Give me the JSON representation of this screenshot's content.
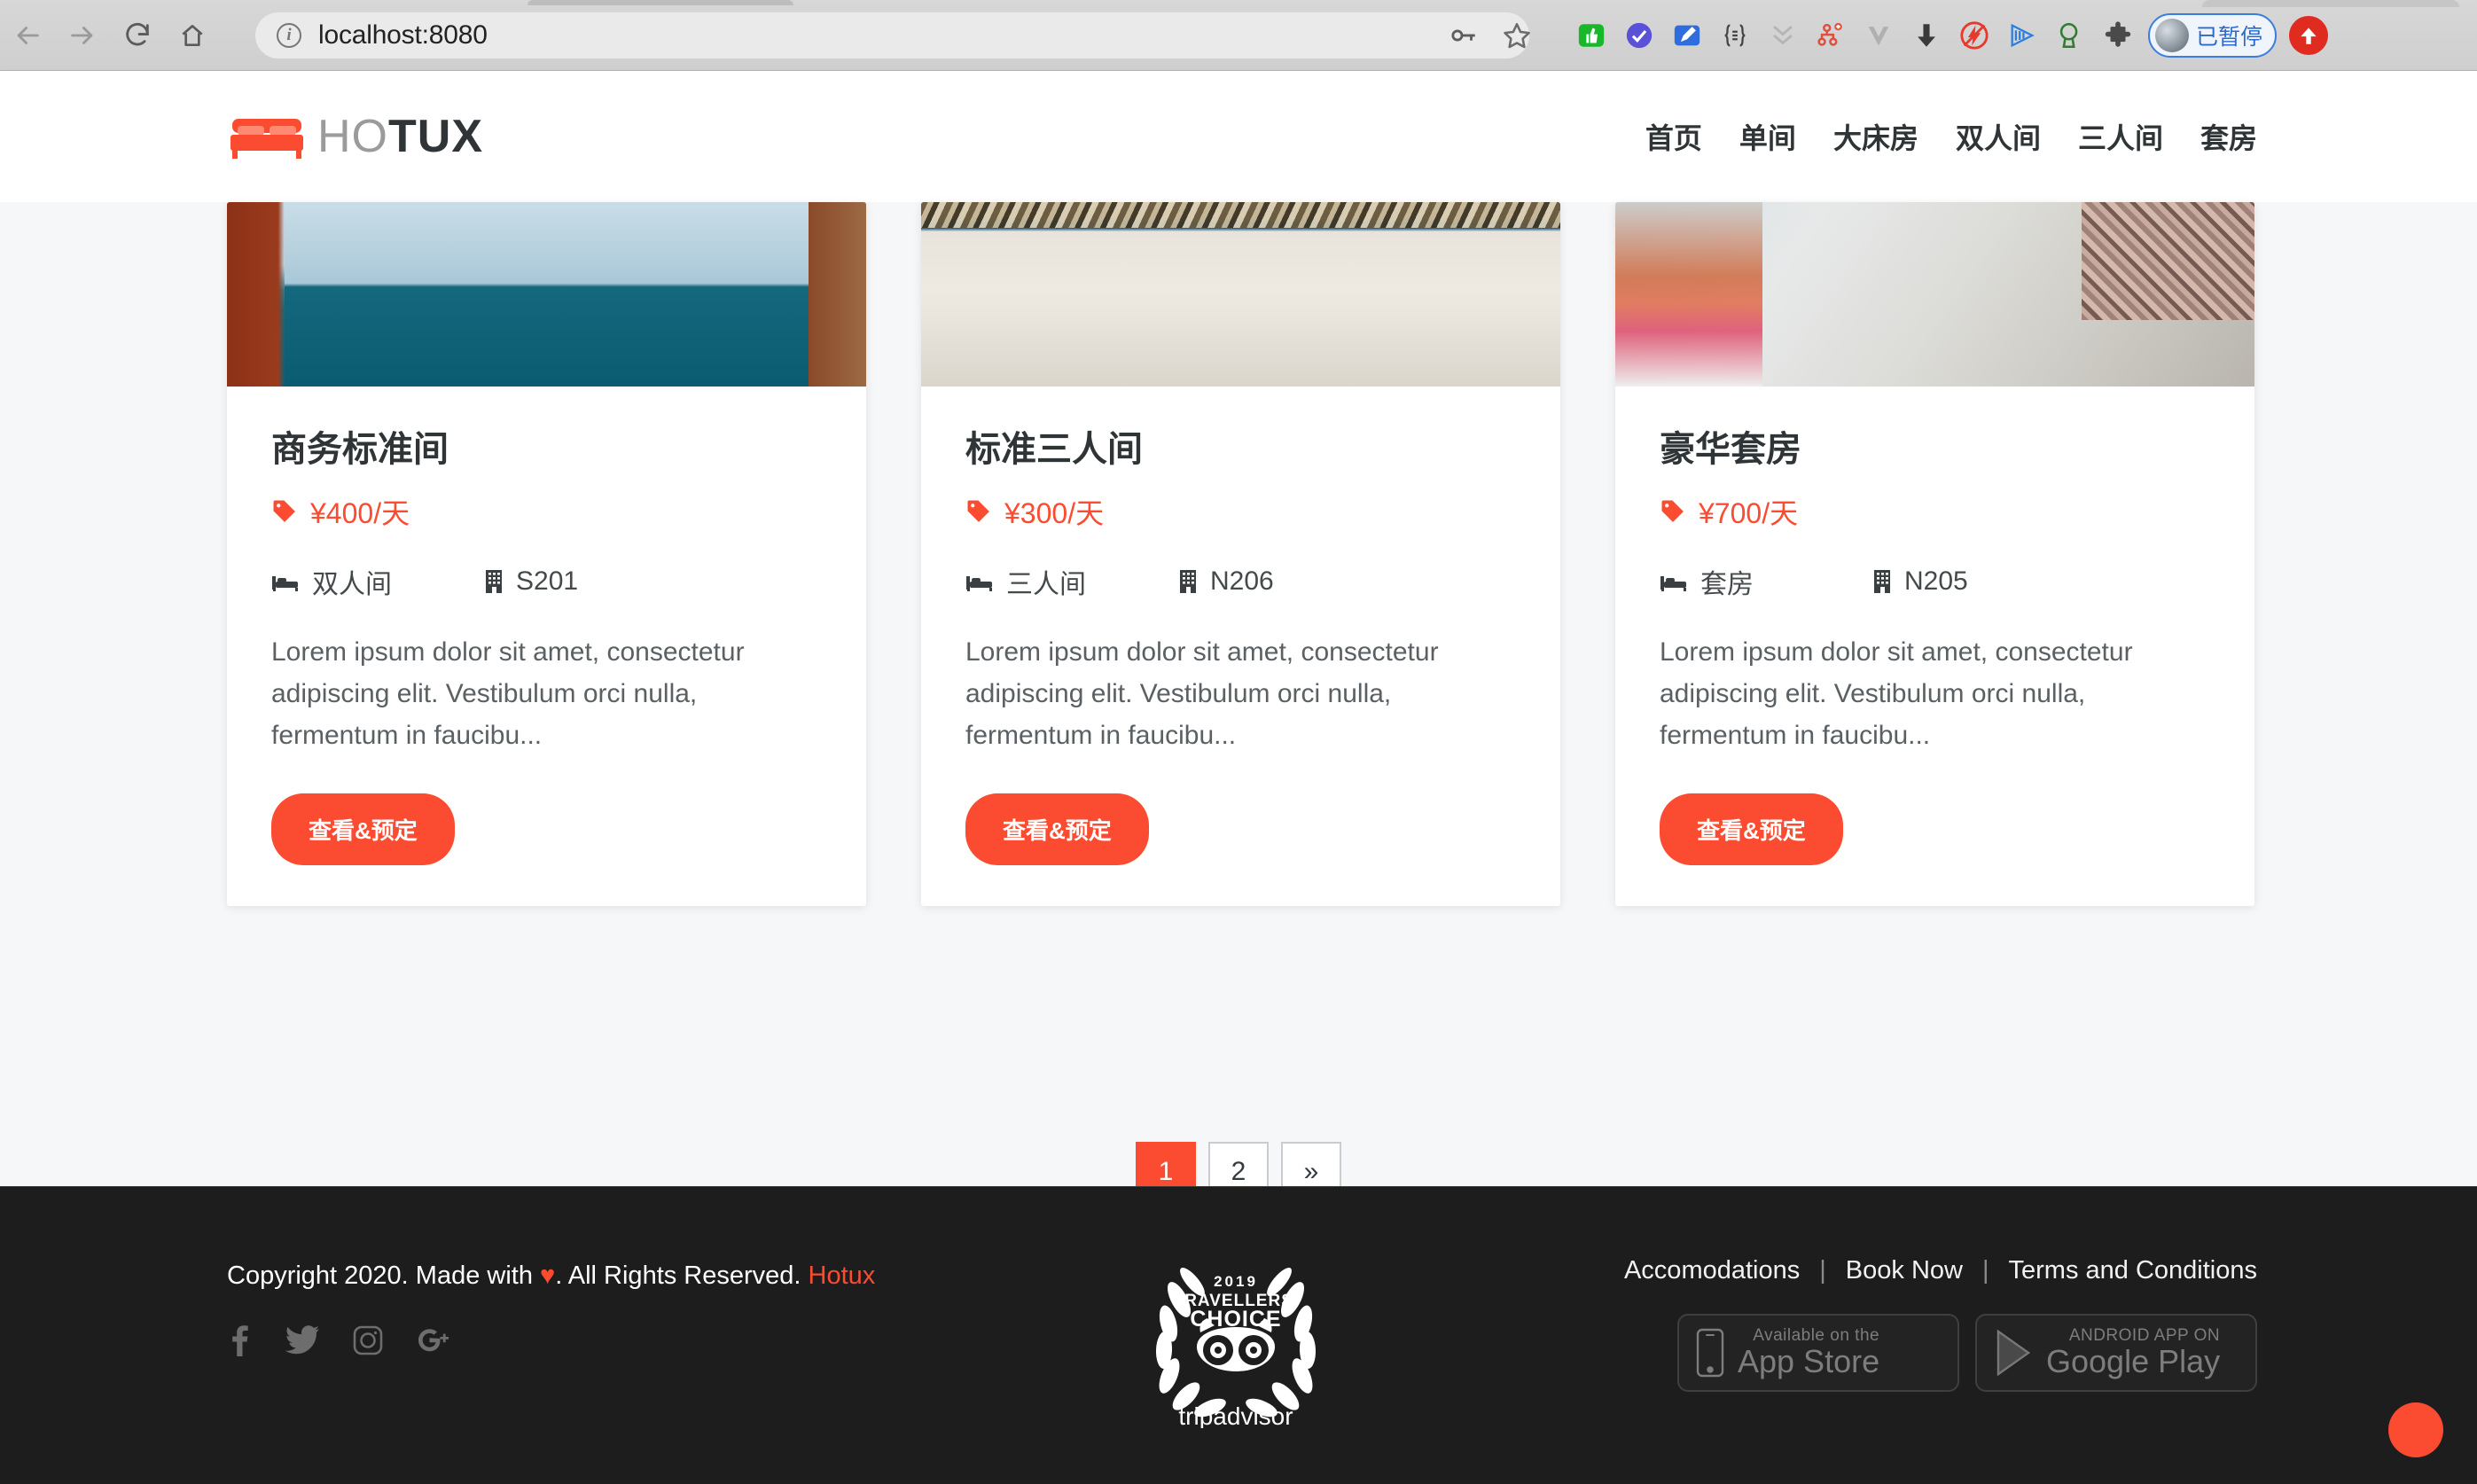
{
  "browser": {
    "back_icon": "back-arrow-icon",
    "forward_icon": "forward-arrow-icon",
    "reload_icon": "reload-icon",
    "home_icon": "home-icon",
    "url": "localhost:8080",
    "info_icon": "info-circle-icon",
    "key_icon": "key-icon",
    "star_icon": "star-icon",
    "extensions": [
      "green-thumb-icon",
      "purple-check-icon",
      "blue-pen-icon",
      "braces-icon",
      "grey-chevron-icon",
      "red-node-icon",
      "grey-v-icon",
      "download-arrow-icon",
      "red-flash-icon",
      "blue-play-icon",
      "green-search-icon",
      "puzzle-icon"
    ],
    "profile_paused_label": "已暂停",
    "profile_badge_icon": "up-arrow-badge-icon"
  },
  "header": {
    "logo_icon": "bed-logo-icon",
    "logo_light": "HO",
    "logo_dark": "TUX",
    "nav": [
      {
        "label": "首页"
      },
      {
        "label": "单间"
      },
      {
        "label": "大床房"
      },
      {
        "label": "双人间"
      },
      {
        "label": "三人间"
      },
      {
        "label": "套房"
      }
    ]
  },
  "rooms": [
    {
      "image": "room-photo-teal-bed",
      "title": "商务标准间",
      "price": "¥400/天",
      "price_icon": "price-tag-icon",
      "bed_icon": "bed-icon",
      "bed_type": "双人间",
      "building_icon": "building-icon",
      "room_no": "S201",
      "description": "Lorem ipsum dolor sit amet, consectetur adipiscing elit. Vestibulum orci nulla, fermentum in faucibu...",
      "button": "查看&预定"
    },
    {
      "image": "room-photo-beige-bed",
      "title": "标准三人间",
      "price": "¥300/天",
      "price_icon": "price-tag-icon",
      "bed_icon": "bed-icon",
      "bed_type": "三人间",
      "building_icon": "building-icon",
      "room_no": "N206",
      "description": "Lorem ipsum dolor sit amet, consectetur adipiscing elit. Vestibulum orci nulla, fermentum in faucibu...",
      "button": "查看&预定"
    },
    {
      "image": "room-photo-suite-bed",
      "title": "豪华套房",
      "price": "¥700/天",
      "price_icon": "price-tag-icon",
      "bed_icon": "bed-icon",
      "bed_type": "套房",
      "building_icon": "building-icon",
      "room_no": "N205",
      "description": "Lorem ipsum dolor sit amet, consectetur adipiscing elit. Vestibulum orci nulla, fermentum in faucibu...",
      "button": "查看&预定"
    }
  ],
  "pagination": {
    "items": [
      {
        "label": "1",
        "active": true
      },
      {
        "label": "2",
        "active": false
      },
      {
        "label": "»",
        "active": false
      }
    ]
  },
  "footer": {
    "copyright_pre": "Copyright 2020. Made with ",
    "heart": "♥",
    "copyright_post": ". All Rights Reserved. ",
    "brand": "Hotux",
    "socials": [
      {
        "name": "facebook-icon"
      },
      {
        "name": "twitter-icon"
      },
      {
        "name": "instagram-icon"
      },
      {
        "name": "google-plus-icon"
      }
    ],
    "badge": {
      "year": "2019",
      "line1": "TRAVELLERS'",
      "line2": "CHOICE",
      "brand": "tripadvisor",
      "icon": "tripadvisor-owl-icon"
    },
    "links": [
      {
        "label": "Accomodations"
      },
      {
        "label": "Book Now"
      },
      {
        "label": "Terms and Conditions"
      }
    ],
    "separator": "|",
    "app_store": {
      "small": "Available on the",
      "big": "App Store",
      "icon": "iphone-icon"
    },
    "google_play": {
      "small": "ANDROID APP ON",
      "big": "Google Play",
      "icon": "play-triangle-icon"
    }
  },
  "colors": {
    "accent": "#fb4b30",
    "dark": "#1d1d1d",
    "text": "#2f3437"
  }
}
